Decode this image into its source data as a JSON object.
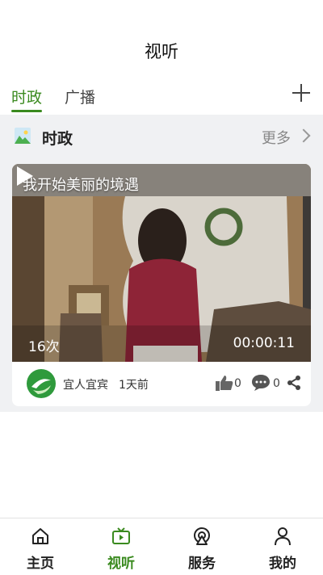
{
  "header": {
    "title": "视听"
  },
  "tabs": [
    {
      "label": "时政",
      "active": true
    },
    {
      "label": "广播",
      "active": false
    }
  ],
  "section": {
    "title": "时政",
    "more_label": "更多"
  },
  "video": {
    "title": "我开始美丽的境遇",
    "views": "16次",
    "duration": "00:00:11",
    "author": "宜人宜宾",
    "time": "1天前",
    "likes": "0",
    "comments": "0"
  },
  "bottom_nav": [
    {
      "label": "主页",
      "icon": "home-icon",
      "active": false
    },
    {
      "label": "视听",
      "icon": "tv-play-icon",
      "active": true
    },
    {
      "label": "服务",
      "icon": "broadcast-icon",
      "active": false
    },
    {
      "label": "我的",
      "icon": "user-icon",
      "active": false
    }
  ],
  "colors": {
    "accent": "#3a8a1f",
    "background": "#f0f1f3"
  }
}
